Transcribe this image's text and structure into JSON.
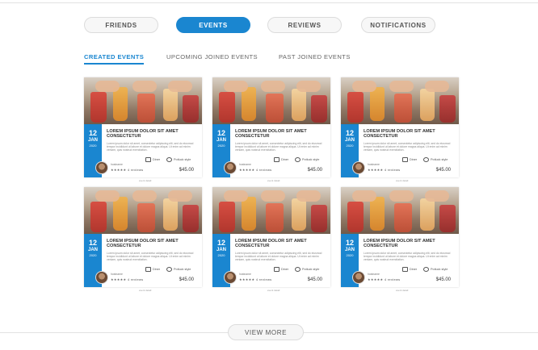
{
  "tabs": {
    "friends": "FRIENDS",
    "events": "EVENTS",
    "reviews": "REVIEWS",
    "notifications": "NOTIFICATIONS",
    "active": "events"
  },
  "subtabs": {
    "created": "CREATED EVENTS",
    "upcoming": "UPCOMING JOINED EVENTS",
    "past": "PAST JOINED EVENTS"
  },
  "card": {
    "day": "12",
    "month": "JAN",
    "year": "2020",
    "title": "LOREM IPSUM DOLOR SIT AMET CONSECTETUR",
    "description": "Lorem ipsum dolor sit amet, consectetur adipiscing elit, sed do eiusmod tempor incididunt ut labore et dolore magna aliqua. Ut enim ad minim veniam, quis nostrud exercitation.",
    "meta_1": "Diner",
    "meta_2": "Potluck style",
    "org": "hostname",
    "rating_stars": "★★★★★",
    "rating_text": "4 reviews",
    "price": "$45.00",
    "caption": "event detail"
  },
  "footer": {
    "view_more": "VIEW MORE"
  },
  "colors": {
    "accent": "#1a86d0"
  }
}
